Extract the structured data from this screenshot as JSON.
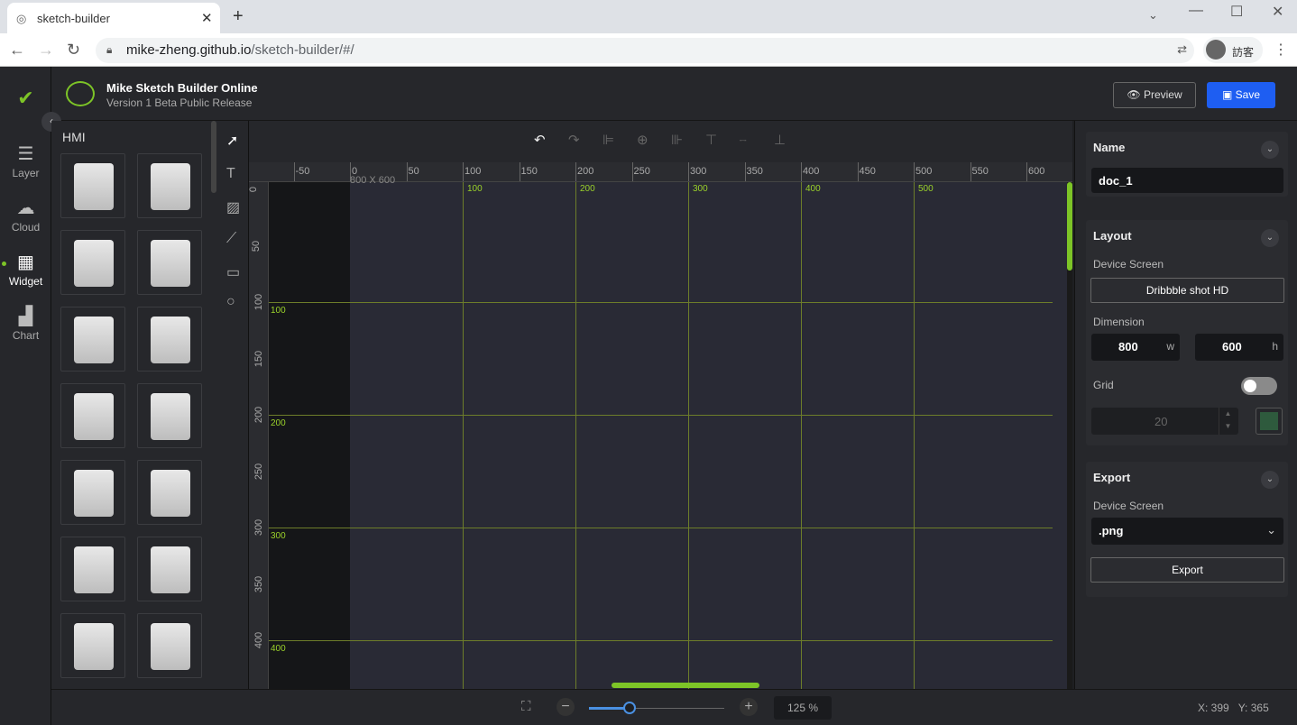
{
  "browser": {
    "tab_title": "sketch-builder",
    "url_host": "mike-zheng.github.io",
    "url_path": "/sketch-builder/#/",
    "profile_label": "訪客"
  },
  "rail": {
    "items": [
      {
        "label": "Layer",
        "icon": "layers-icon"
      },
      {
        "label": "Cloud",
        "icon": "cloud-icon"
      },
      {
        "label": "Widget",
        "icon": "widget-icon"
      },
      {
        "label": "Chart",
        "icon": "chart-icon"
      }
    ]
  },
  "header": {
    "title": "Mike Sketch Builder Online",
    "subtitle": "Version 1 Beta Public Release",
    "preview_label": "Preview",
    "save_label": "Save"
  },
  "widget_panel": {
    "category": "HMI",
    "widgets_count_visible": 14
  },
  "canvas": {
    "artboard_label": "800 X 600",
    "ruler_top": [
      "-50",
      "0",
      "50",
      "100",
      "150",
      "200",
      "250",
      "300",
      "350",
      "400",
      "450",
      "500",
      "550",
      "600"
    ],
    "ruler_left": [
      "0",
      "50",
      "100",
      "150",
      "200",
      "250",
      "300",
      "350",
      "400"
    ],
    "grid_top_labels": [
      "100",
      "200",
      "300",
      "400",
      "500"
    ],
    "grid_left_labels": [
      "100",
      "200",
      "300",
      "400"
    ]
  },
  "properties": {
    "name_title": "Name",
    "name_value": "doc_1",
    "layout_title": "Layout",
    "device_screen_label": "Device Screen",
    "device_screen_value": "Dribbble shot HD",
    "dimension_label": "Dimension",
    "width": "800",
    "width_unit": "w",
    "height": "600",
    "height_unit": "h",
    "grid_label": "Grid",
    "grid_enabled": false,
    "grid_size": "20",
    "grid_color": "#2e5a3d",
    "export_title": "Export",
    "export_device_label": "Device Screen",
    "export_format": ".png",
    "export_button": "Export"
  },
  "bottom": {
    "zoom": "125 %",
    "zoom_fraction": 0.3,
    "coord_x": "X: 399",
    "coord_y": "Y: 365"
  }
}
